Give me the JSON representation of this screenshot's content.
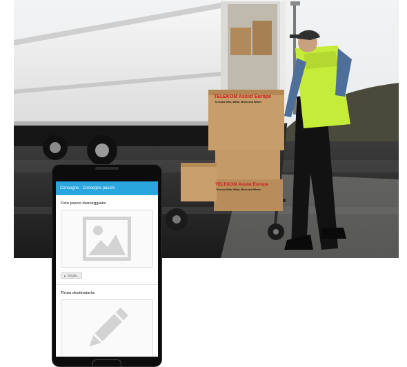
{
  "photo": {
    "box_brand": "TELEKOM Assist Europe",
    "box_tagline": "To know Who, What, When and Where",
    "box2_brand": "TELEKOM Assist Europe",
    "box2_tagline": "To know Who, What, When and Where"
  },
  "app": {
    "header_title": "Consegne - Consegna pacchi",
    "photo_section_label": "Foto pacco danneggiato:",
    "photo_placeholder_icon": "image-icon",
    "browse_button_label": "Sfoglia...",
    "signature_section_label": "Firma destinatario:",
    "signature_placeholder_icon": "pencil-icon"
  },
  "colors": {
    "header_bg": "#2aa6df",
    "brand_red": "#d4141c",
    "vest": "#c6ec3a"
  }
}
